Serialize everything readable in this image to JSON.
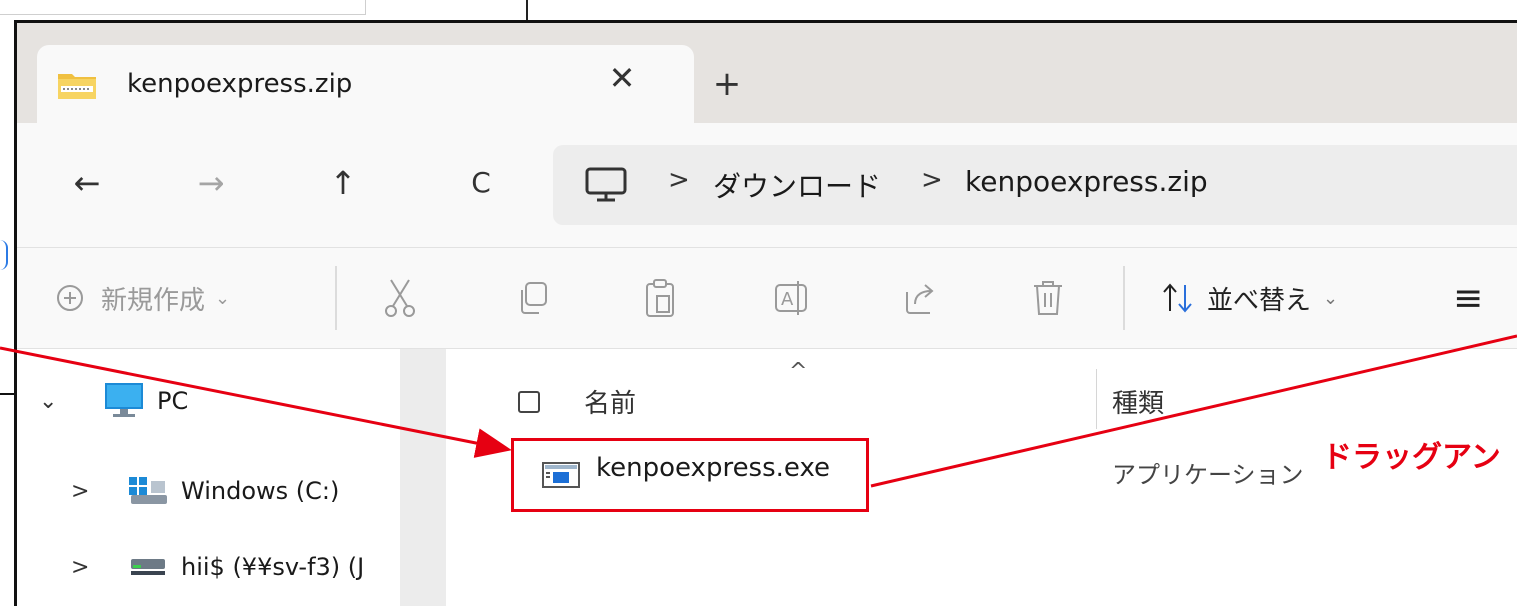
{
  "tab": {
    "title": "kenpoexpress.zip",
    "close_glyph": "✕",
    "new_tab_glyph": "+"
  },
  "nav": {
    "back_glyph": "←",
    "forward_glyph": "→",
    "up_glyph": "↑",
    "refresh_glyph": "C"
  },
  "address": {
    "separator": ">",
    "crumbs": [
      "ダウンロード",
      "kenpoexpress.zip"
    ]
  },
  "toolbar": {
    "new_label": "新規作成",
    "new_caret": "⌄",
    "sort_label": "並べ替え",
    "sort_caret": "⌄",
    "view_glyph": "≡"
  },
  "navpane": {
    "items": [
      {
        "label": "PC",
        "chevron": "⌄",
        "icon": "monitor-icon"
      },
      {
        "label": "Windows (C:)",
        "chevron": ">",
        "icon": "windows-drive-icon"
      },
      {
        "label": "hii$ (¥¥sv-f3) (J",
        "chevron": ">",
        "icon": "network-drive-icon"
      }
    ]
  },
  "files": {
    "sort_indicator": "^",
    "header_name": "名前",
    "header_type": "種類",
    "rows": [
      {
        "name": "kenpoexpress.exe",
        "type": "アプリケーション",
        "icon": "application-icon"
      }
    ]
  },
  "annotation": {
    "label": "ドラッグアン",
    "color": "#e60012"
  }
}
